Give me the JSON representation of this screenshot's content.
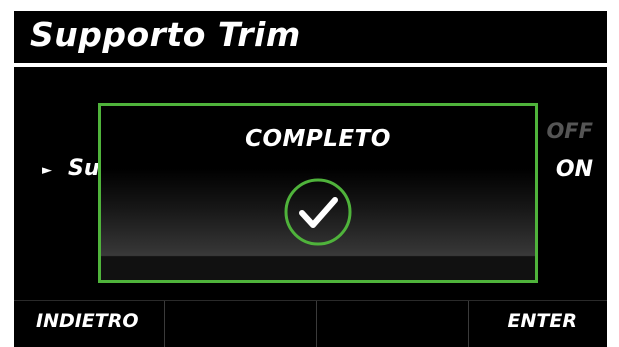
{
  "header": {
    "title": "Supporto Trim"
  },
  "setting": {
    "pointer": "►",
    "label": "Su",
    "options": {
      "off": "OFF",
      "on": "ON"
    }
  },
  "dialog": {
    "title": "COMPLETO",
    "icon": "check-circle-icon",
    "accent_color": "#4fb33b"
  },
  "footer": {
    "back_label": "INDIETRO",
    "enter_label": "ENTER"
  }
}
